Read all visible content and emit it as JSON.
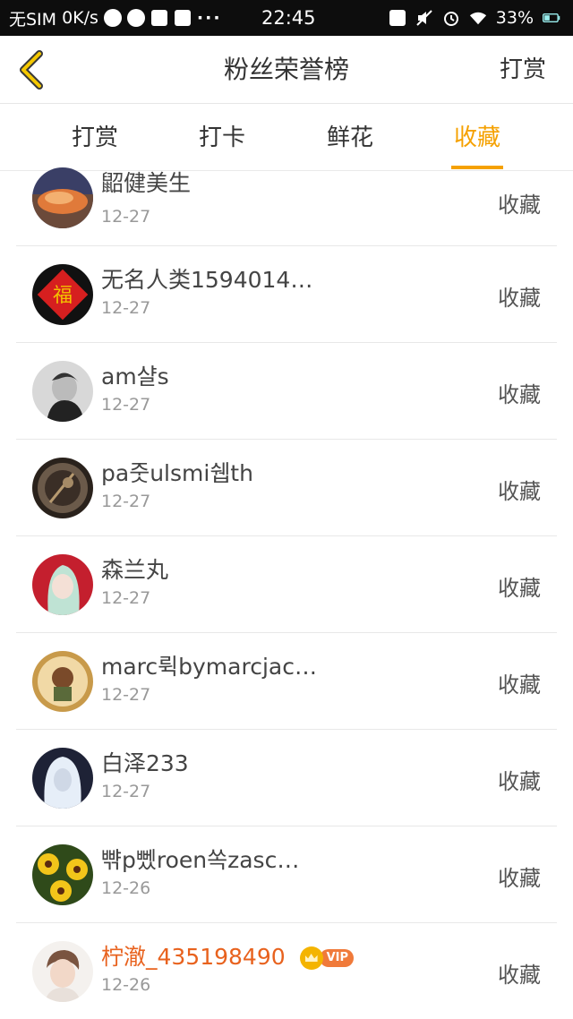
{
  "status_bar": {
    "carrier": "无SIM",
    "speed": "0K/s",
    "more": "···",
    "time": "22:45",
    "battery": "33%"
  },
  "header": {
    "back_icon": "chevron-left-icon",
    "title": "粉丝荣誉榜",
    "right_action": "打赏"
  },
  "tabs": [
    {
      "label": "打赏",
      "active": false
    },
    {
      "label": "打卡",
      "active": false
    },
    {
      "label": "鲜花",
      "active": false
    },
    {
      "label": "收藏",
      "active": true
    }
  ],
  "colors": {
    "accent": "#f5a100",
    "vip_name": "#e8621e"
  },
  "rows": [
    {
      "name": "鼦健美生",
      "date": "12-27",
      "action": "收藏"
    },
    {
      "name": "无名人类1594014…",
      "date": "12-27",
      "action": "收藏"
    },
    {
      "name": "am샬s",
      "date": "12-27",
      "action": "收藏"
    },
    {
      "name": "pa줏ulsmi쉡th",
      "date": "12-27",
      "action": "收藏"
    },
    {
      "name": "森兰丸",
      "date": "12-27",
      "action": "收藏"
    },
    {
      "name": "marc뤽bymarcjac…",
      "date": "12-27",
      "action": "收藏"
    },
    {
      "name": "白泽233",
      "date": "12-27",
      "action": "收藏"
    },
    {
      "name": "뺚p뼀roen쏙zasc…",
      "date": "12-26",
      "action": "收藏"
    },
    {
      "name": "柠澈_435198490",
      "date": "12-26",
      "action": "收藏",
      "vip": "VIP"
    }
  ]
}
